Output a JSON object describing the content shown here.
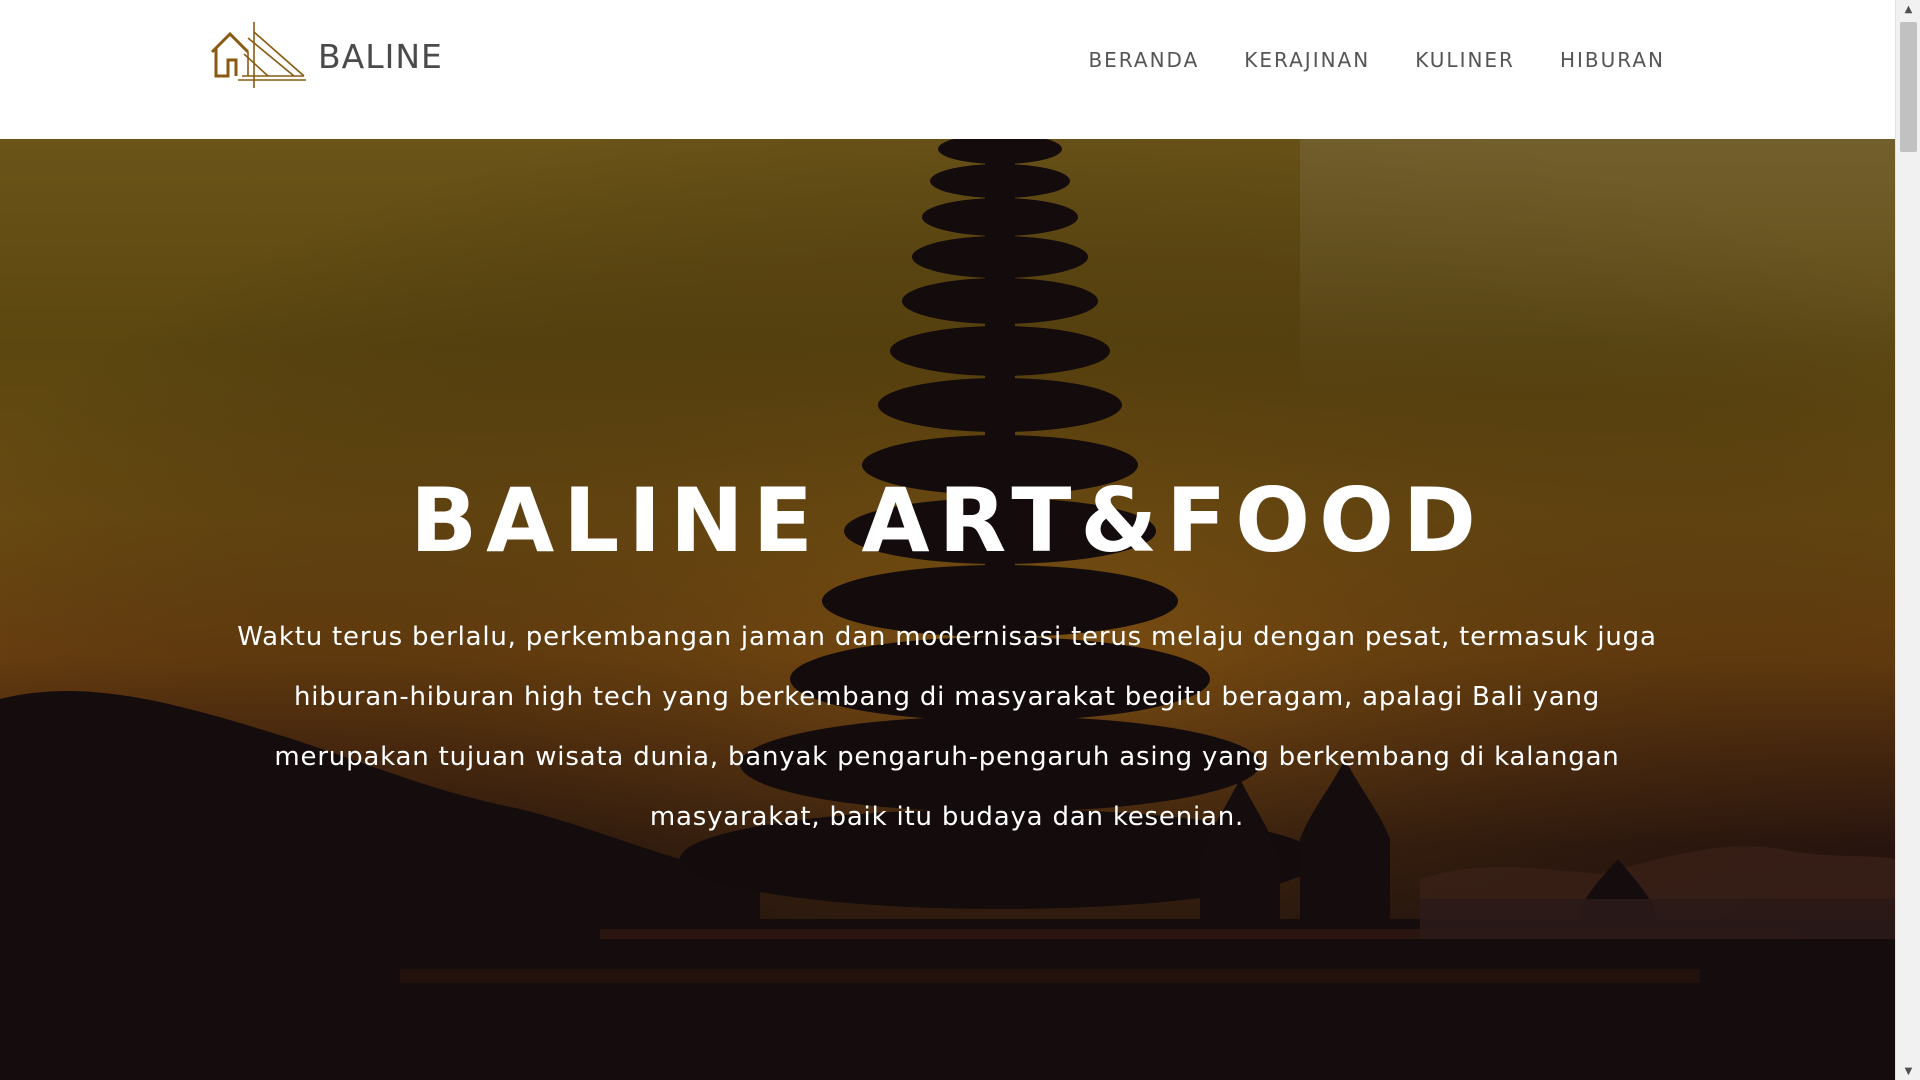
{
  "header": {
    "brand_name": "BALINE",
    "logo_icon": "house-logo-icon",
    "nav": [
      {
        "label": "BERANDA"
      },
      {
        "label": "KERAJINAN"
      },
      {
        "label": "KULINER"
      },
      {
        "label": "HIBURAN"
      }
    ]
  },
  "hero": {
    "title": "BALINE ART&FOOD",
    "text": "Waktu terus berlalu, perkembangan jaman dan modernisasi terus melaju dengan pesat, termasuk juga hiburan-hiburan high tech yang berkembang di masyarakat begitu beragam, apalagi Bali yang merupakan tujuan wisata dunia, banyak pengaruh-pengaruh asing yang berkembang di kalangan masyarakat, baik itu budaya dan kesenian."
  },
  "colors": {
    "brand_accent": "#8a5a12",
    "nav_text": "#555555",
    "hero_text": "#ffffff"
  }
}
